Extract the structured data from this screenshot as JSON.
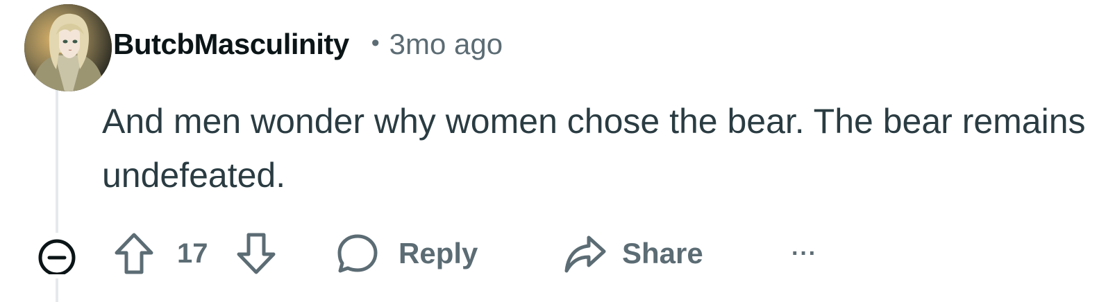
{
  "comment": {
    "username": "ButcbMasculinity",
    "separator": "•",
    "timestamp": "3mo ago",
    "body": "And men wonder why women chose the bear. The bear remains undefeated.",
    "score": "17",
    "avatar_icon": "anime-character-avatar"
  },
  "actions": {
    "collapse_icon": "minus-circle-icon",
    "upvote_icon": "arrow-up-icon",
    "downvote_icon": "arrow-down-icon",
    "reply_label": "Reply",
    "share_label": "Share",
    "more_label": "···"
  },
  "colors": {
    "text_primary": "#0b1416",
    "text_body": "#2a3c42",
    "text_secondary": "#5c6c74",
    "thread_line": "#e5e9eb"
  }
}
